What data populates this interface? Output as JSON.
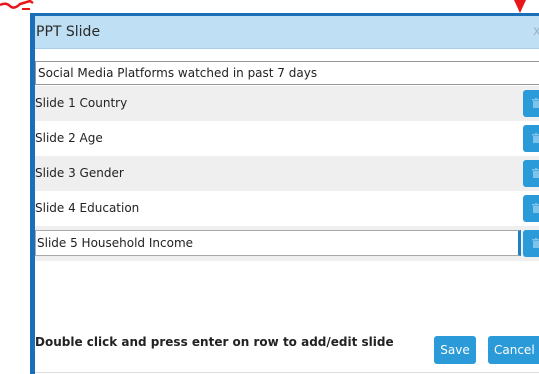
{
  "colors": {
    "dialog_border": "#1a6fb8",
    "titlebar_bg": "#bfdff4",
    "accent_button": "#2a9ad8",
    "row_shade": "#efefef",
    "annotation_red": "#e8161b"
  },
  "dialog": {
    "title": "PPT Slide",
    "close_icon": "close-icon",
    "close_label": "x"
  },
  "deck_name": {
    "value": "Social Media Platforms watched in past 7 days"
  },
  "slides": [
    {
      "label": "Slide 1 Country",
      "shaded": true,
      "editing": false,
      "delete_icon": "trash-icon"
    },
    {
      "label": "Slide 2 Age",
      "shaded": false,
      "editing": false,
      "delete_icon": "trash-icon"
    },
    {
      "label": "Slide 3 Gender",
      "shaded": true,
      "editing": false,
      "delete_icon": "trash-icon"
    },
    {
      "label": "Slide 4 Education",
      "shaded": false,
      "editing": false,
      "delete_icon": "trash-icon"
    },
    {
      "label": "Slide 5 Household Income",
      "shaded": true,
      "editing": true,
      "delete_icon": "trash-icon"
    }
  ],
  "footer": {
    "hint": "Double click and press enter on row to add/edit slide",
    "save_label": "Save",
    "cancel_label": "Cancel"
  },
  "annotations": {
    "arrow_icon": "red-arrow-icon",
    "corner_mark_icon": "red-mark-icon"
  }
}
